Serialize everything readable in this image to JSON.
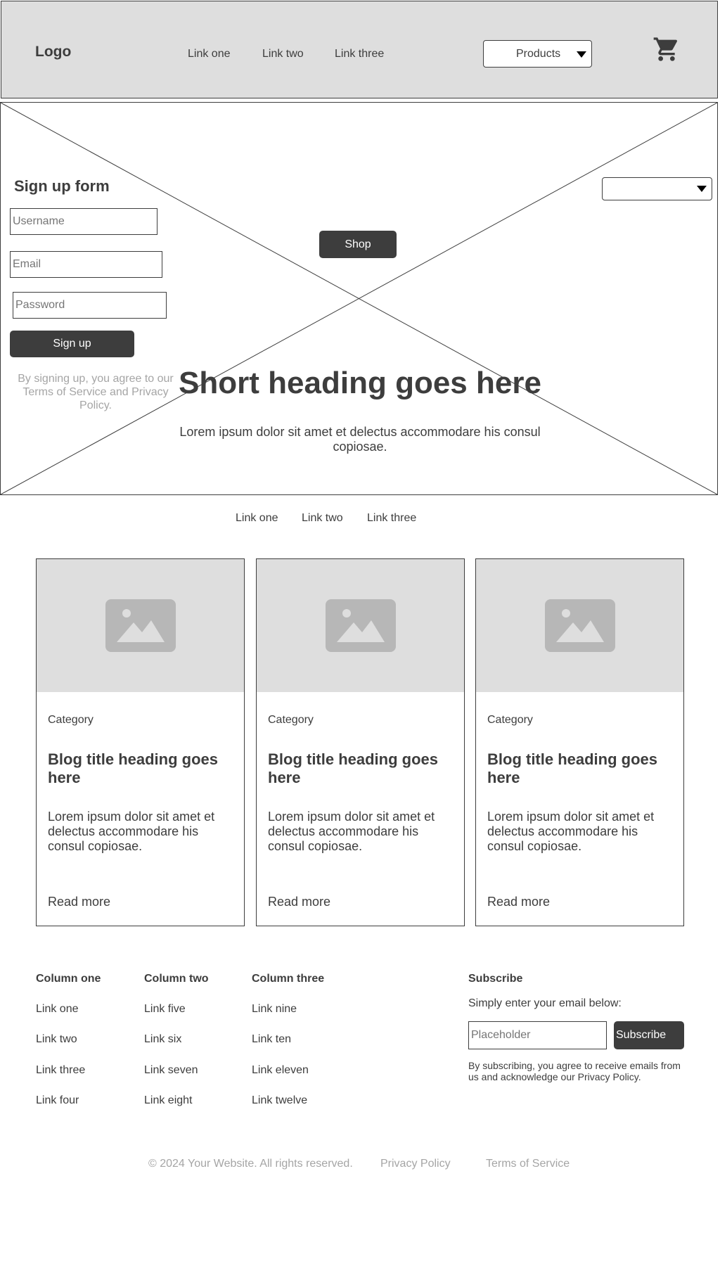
{
  "header": {
    "logo": "Logo",
    "nav": [
      "Link one",
      "Link two",
      "Link three"
    ],
    "products_label": "Products",
    "cart_icon": "shopping-cart-icon"
  },
  "hero": {
    "form_title": "Sign up form",
    "username_placeholder": "Username",
    "email_placeholder": "Email",
    "password_placeholder": "Password",
    "signup_label": "Sign up",
    "terms": "By signing up, you agree to our Terms of Service and Privacy Policy.",
    "shop_label": "Shop",
    "dropdown_value": "",
    "heading": "Short heading goes here",
    "text": "Lorem ipsum dolor sit amet et delectus accommodare his consul copiosae."
  },
  "subnav": [
    "Link one",
    "Link two",
    "Link three"
  ],
  "cards": [
    {
      "category": "Category",
      "title": "Blog title heading goes here",
      "body": "Lorem ipsum dolor sit amet et delectus accommodare his consul copiosae.",
      "more": "Read more"
    },
    {
      "category": "Category",
      "title": "Blog title heading goes here",
      "body": "Lorem ipsum dolor sit amet et delectus accommodare his consul copiosae.",
      "more": "Read more"
    },
    {
      "category": "Category",
      "title": "Blog title heading goes here",
      "body": "Lorem ipsum dolor sit amet et delectus accommodare his consul copiosae.",
      "more": "Read more"
    }
  ],
  "footer": {
    "columns": [
      {
        "heading": "Column one",
        "links": [
          "Link one",
          "Link two",
          "Link three",
          "Link four"
        ]
      },
      {
        "heading": "Column two",
        "links": [
          "Link five",
          "Link six",
          "Link seven",
          "Link eight"
        ]
      },
      {
        "heading": "Column three",
        "links": [
          "Link nine",
          "Link ten",
          "Link eleven",
          "Link twelve"
        ]
      }
    ],
    "subscribe": {
      "heading": "Subscribe",
      "text": "Simply enter your email below:",
      "placeholder": "Placeholder",
      "button": "Subscribe",
      "note": "By subscribing, you agree to receive emails from us and acknowledge our Privacy Policy."
    },
    "copyright": "© 2024 Your Website. All rights reserved.",
    "privacy": "Privacy Policy",
    "terms": "Terms of Service"
  },
  "colors": {
    "dark": "#3d3d3d",
    "light_gray": "#dedede",
    "muted": "#a5a5a5"
  }
}
